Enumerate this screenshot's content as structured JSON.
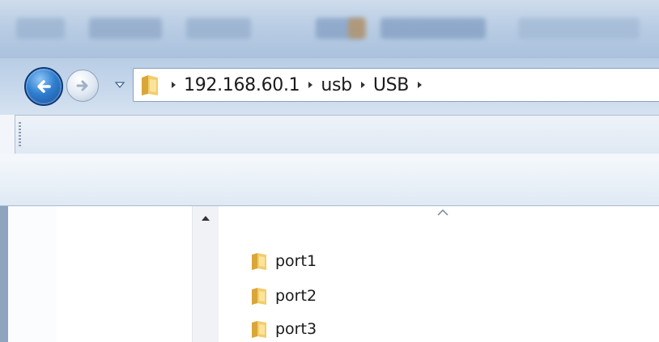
{
  "address_bar": {
    "breadcrumbs": [
      "192.168.60.1",
      "usb",
      "USB"
    ]
  },
  "file_list": {
    "items": [
      {
        "name": "port1",
        "icon": "folder-icon"
      },
      {
        "name": "port2",
        "icon": "folder-icon"
      },
      {
        "name": "port3",
        "icon": "folder-icon"
      }
    ]
  },
  "colors": {
    "titlebar": "#b9cde4",
    "back_button": "#2f7ed0",
    "folder": "#e9b94a"
  }
}
